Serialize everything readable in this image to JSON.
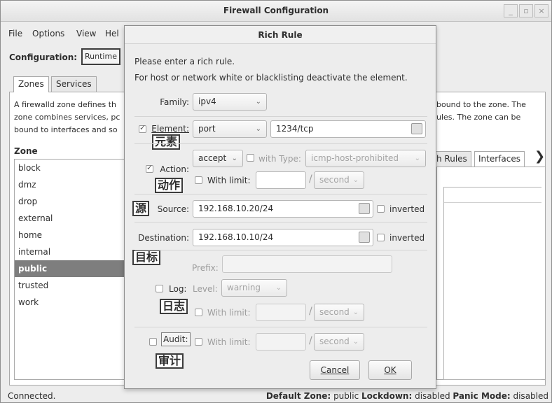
{
  "window": {
    "title": "Firewall Configuration"
  },
  "menu": {
    "file": "File",
    "options": "Options",
    "view": "View",
    "help": "Hel"
  },
  "toolbar": {
    "configuration_label": "Configuration:",
    "runtime": "Runtime"
  },
  "tabs": {
    "zones": "Zones",
    "services": "Services"
  },
  "left": {
    "desc_line1": "A firewalld zone defines th",
    "desc_line2": "zone combines services, pc",
    "desc_line3": "bound to interfaces and so",
    "desc_right1": "bound to the zone. The",
    "desc_right2": "ules. The zone can be",
    "zone_header": "Zone",
    "zones": [
      "block",
      "dmz",
      "drop",
      "external",
      "home",
      "internal",
      "public",
      "trusted",
      "work"
    ]
  },
  "right_tabs": {
    "rich_rules": "h Rules",
    "interfaces": "Interfaces",
    "more": "❯"
  },
  "status": {
    "connected": "Connected.",
    "default_zone_label": "Default Zone:",
    "default_zone": "public",
    "lockdown_label": "Lockdown:",
    "lockdown": "disabled",
    "panic_label": "Panic Mode:",
    "panic": "disabled"
  },
  "dialog": {
    "title": "Rich Rule",
    "intro1": "Please enter a rich rule.",
    "intro2": "For host or network white or blacklisting deactivate the element.",
    "family_label": "Family:",
    "family_value": "ipv4",
    "element_label": "Element:",
    "element_type": "port",
    "element_value": "1234/tcp",
    "action_label": "Action:",
    "action_value": "accept",
    "with_type_label": "with Type:",
    "with_type_value": "icmp-host-prohibited",
    "with_limit_label": "With limit:",
    "limit_unit": "second",
    "source_label": "Source:",
    "source_value": "192.168.10.20/24",
    "inverted": "inverted",
    "destination_label": "Destination:",
    "destination_value": "192.168.10.10/24",
    "prefix_label": "Prefix:",
    "log_label": "Log:",
    "level_label": "Level:",
    "level_value": "warning",
    "audit_label": "Audit:",
    "cancel": "Cancel",
    "ok": "OK"
  },
  "annotations": {
    "element": "元素",
    "action": "动作",
    "source": "源",
    "destination": "目标",
    "log": "日志",
    "audit": "审计"
  },
  "icons": {
    "arrow": "⌄",
    "slash": "/"
  }
}
